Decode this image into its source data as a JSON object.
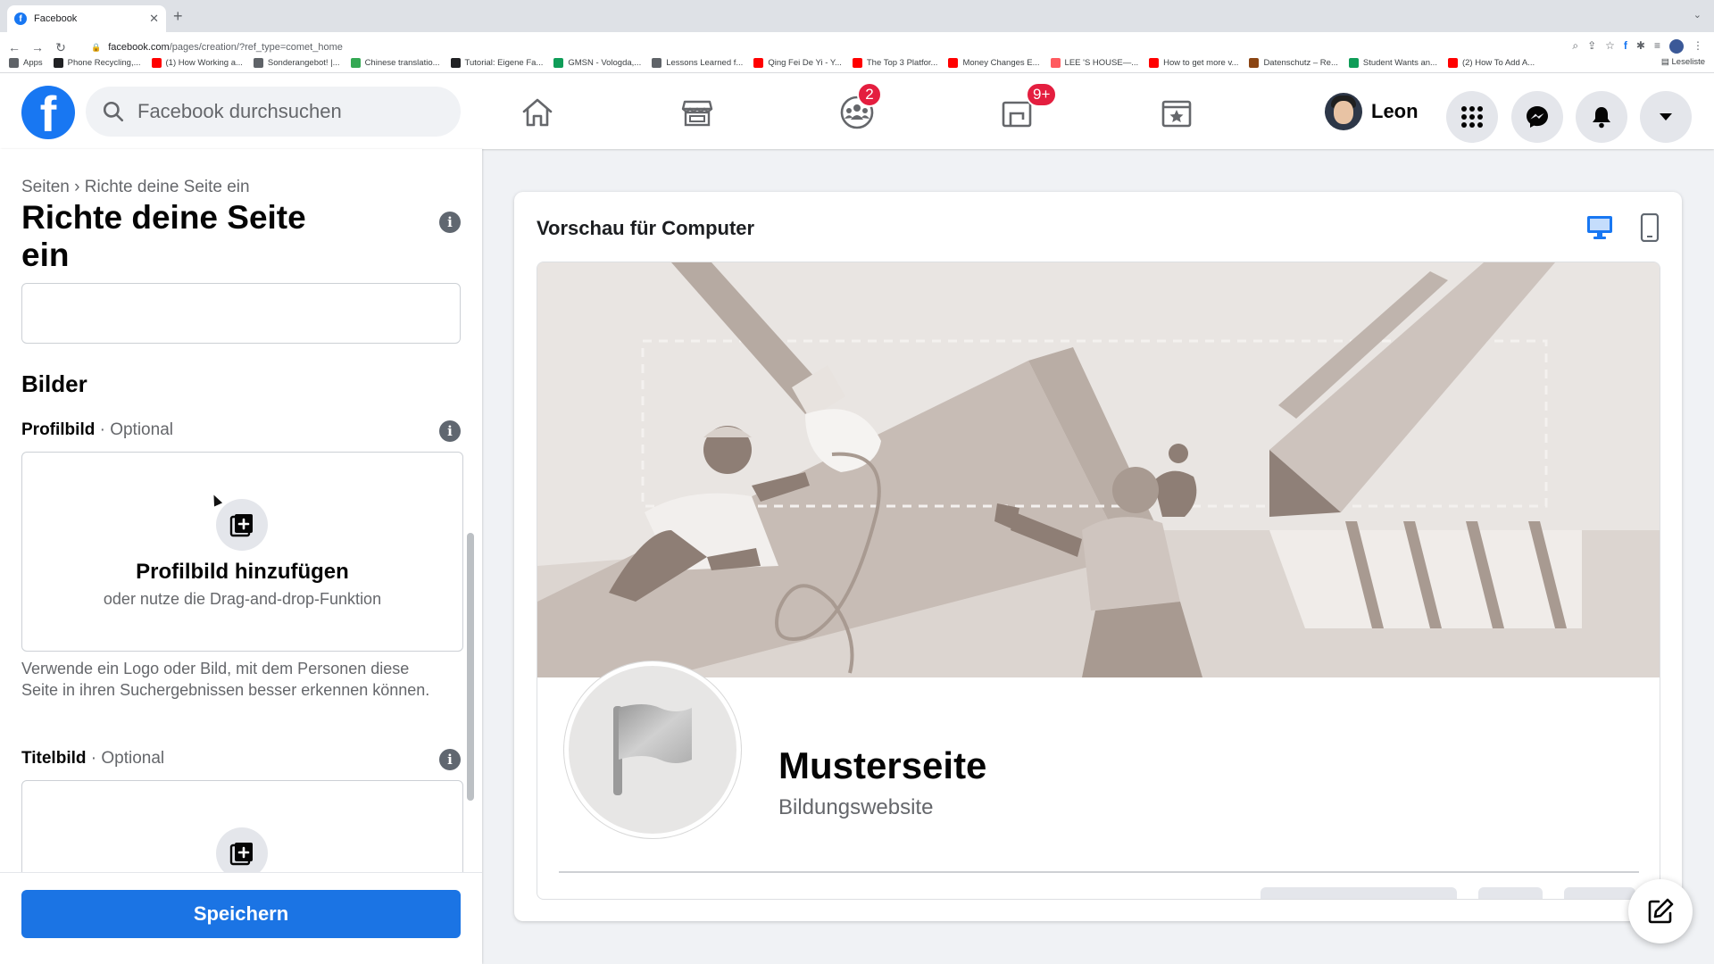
{
  "browser": {
    "tab_title": "Facebook",
    "tab_favicon": "f",
    "new_tab_symbol": "+",
    "url_host": "facebook.com",
    "url_path": "/pages/creation/?ref_type=comet_home",
    "bookmarks": [
      {
        "label": "Apps",
        "color": "#5f6368"
      },
      {
        "label": "Phone Recycling,...",
        "color": "#202124"
      },
      {
        "label": "(1) How Working a...",
        "color": "#ff0000"
      },
      {
        "label": "Sonderangebot! |...",
        "color": "#5f6368"
      },
      {
        "label": "Chinese translatio...",
        "color": "#34a853"
      },
      {
        "label": "Tutorial: Eigene Fa...",
        "color": "#202124"
      },
      {
        "label": "GMSN - Vologda,...",
        "color": "#0f9d58"
      },
      {
        "label": "Lessons Learned f...",
        "color": "#5f6368"
      },
      {
        "label": "Qing Fei De Yi - Y...",
        "color": "#ff0000"
      },
      {
        "label": "The Top 3 Platfor...",
        "color": "#ff0000"
      },
      {
        "label": "Money Changes E...",
        "color": "#ff0000"
      },
      {
        "label": "LEE 'S HOUSE—...",
        "color": "#ff5a5f"
      },
      {
        "label": "How to get more v...",
        "color": "#ff0000"
      },
      {
        "label": "Datenschutz – Re...",
        "color": "#8b4513"
      },
      {
        "label": "Student Wants an...",
        "color": "#0f9d58"
      },
      {
        "label": "(2) How To Add A...",
        "color": "#ff0000"
      }
    ],
    "reading_list": "Leseliste"
  },
  "header": {
    "logo": "f",
    "search_placeholder": "Facebook durchsuchen",
    "groups_badge": "2",
    "gaming_badge": "9+",
    "user_name": "Leon"
  },
  "left_panel": {
    "breadcrumb": "Seiten › Richte deine Seite ein",
    "title": "Richte deine Seite ein",
    "info_glyph": "i",
    "section_images": "Bilder",
    "profile_label": "Profilbild",
    "optional_suffix": " · Optional",
    "profile_upload_title": "Profilbild hinzufügen",
    "profile_upload_sub": "oder nutze die Drag-and-drop-Funktion",
    "helper_text": "Verwende ein Logo oder Bild, mit dem Personen diese Seite in ihren Suchergebnissen besser erkennen können.",
    "cover_label": "Titelbild",
    "save_label": "Speichern"
  },
  "preview": {
    "title": "Vorschau für Computer",
    "page_name": "Musterseite",
    "page_category": "Bildungswebsite"
  },
  "colors": {
    "fb_blue": "#1877f2",
    "save_blue": "#1b74e4",
    "badge_red": "#e41e3f",
    "cover_bg": "#e9e5e2"
  }
}
